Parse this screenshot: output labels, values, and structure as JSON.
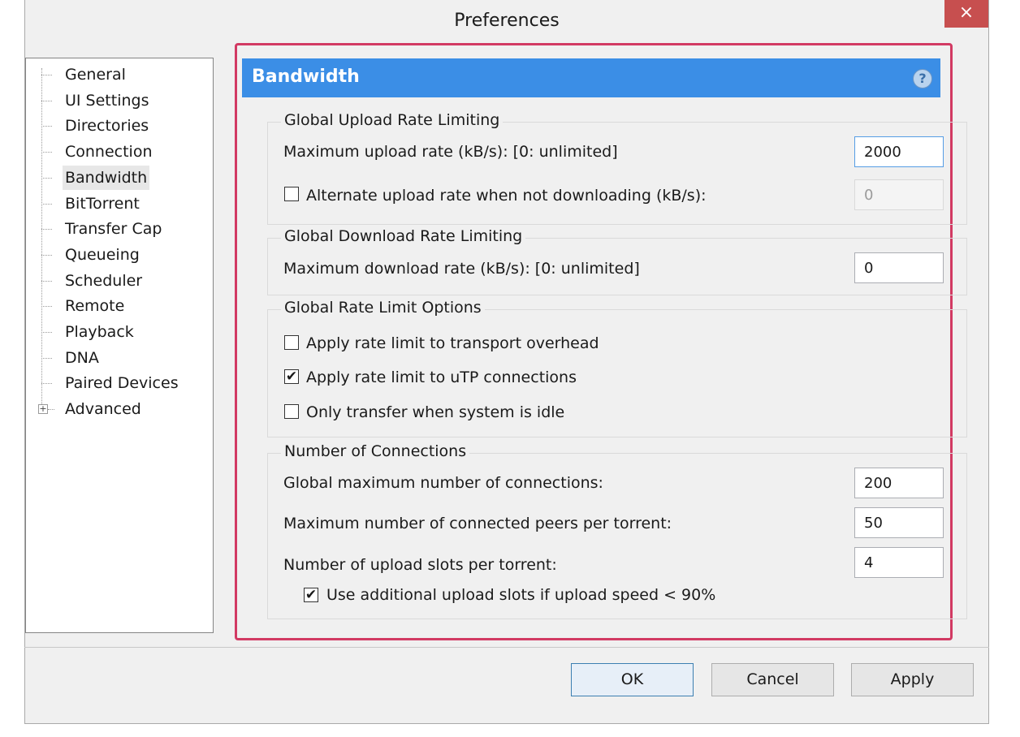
{
  "window": {
    "title": "Preferences",
    "close_glyph": "×"
  },
  "tree": {
    "items": [
      {
        "label": "General"
      },
      {
        "label": "UI Settings"
      },
      {
        "label": "Directories"
      },
      {
        "label": "Connection"
      },
      {
        "label": "Bandwidth",
        "selected": true
      },
      {
        "label": "BitTorrent"
      },
      {
        "label": "Transfer Cap"
      },
      {
        "label": "Queueing"
      },
      {
        "label": "Scheduler"
      },
      {
        "label": "Remote"
      },
      {
        "label": "Playback"
      },
      {
        "label": "DNA"
      },
      {
        "label": "Paired Devices"
      },
      {
        "label": "Advanced",
        "expandable": true,
        "expand_glyph": "+"
      }
    ]
  },
  "panel": {
    "title": "Bandwidth",
    "help_glyph": "?",
    "upload_group": {
      "title": "Global Upload Rate Limiting",
      "max_upload_label": "Maximum upload rate (kB/s): [0: unlimited]",
      "max_upload_value": "2000",
      "alt_upload_label": "Alternate upload rate when not downloading (kB/s):",
      "alt_upload_checked": false,
      "alt_upload_value": "0"
    },
    "download_group": {
      "title": "Global Download Rate Limiting",
      "max_download_label": "Maximum download rate (kB/s): [0: unlimited]",
      "max_download_value": "0"
    },
    "options_group": {
      "title": "Global Rate Limit Options",
      "apply_overhead_label": "Apply rate limit to transport overhead",
      "apply_overhead_checked": false,
      "apply_utp_label": "Apply rate limit to uTP connections",
      "apply_utp_checked": true,
      "idle_only_label": "Only transfer when system is idle",
      "idle_only_checked": false
    },
    "connections_group": {
      "title": "Number of Connections",
      "global_max_label": "Global maximum number of connections:",
      "global_max_value": "200",
      "peers_label": "Maximum number of connected peers per torrent:",
      "peers_value": "50",
      "slots_label": "Number of upload slots per torrent:",
      "slots_value": "4",
      "extra_slots_label": "Use additional upload slots if upload speed < 90%",
      "extra_slots_checked": true
    }
  },
  "buttons": {
    "ok": "OK",
    "cancel": "Cancel",
    "apply": "Apply"
  },
  "colors": {
    "header_blue": "#3b8ee6",
    "highlight_frame": "#d23a63",
    "close_red": "#c74f4f"
  },
  "check_glyph": "✔"
}
